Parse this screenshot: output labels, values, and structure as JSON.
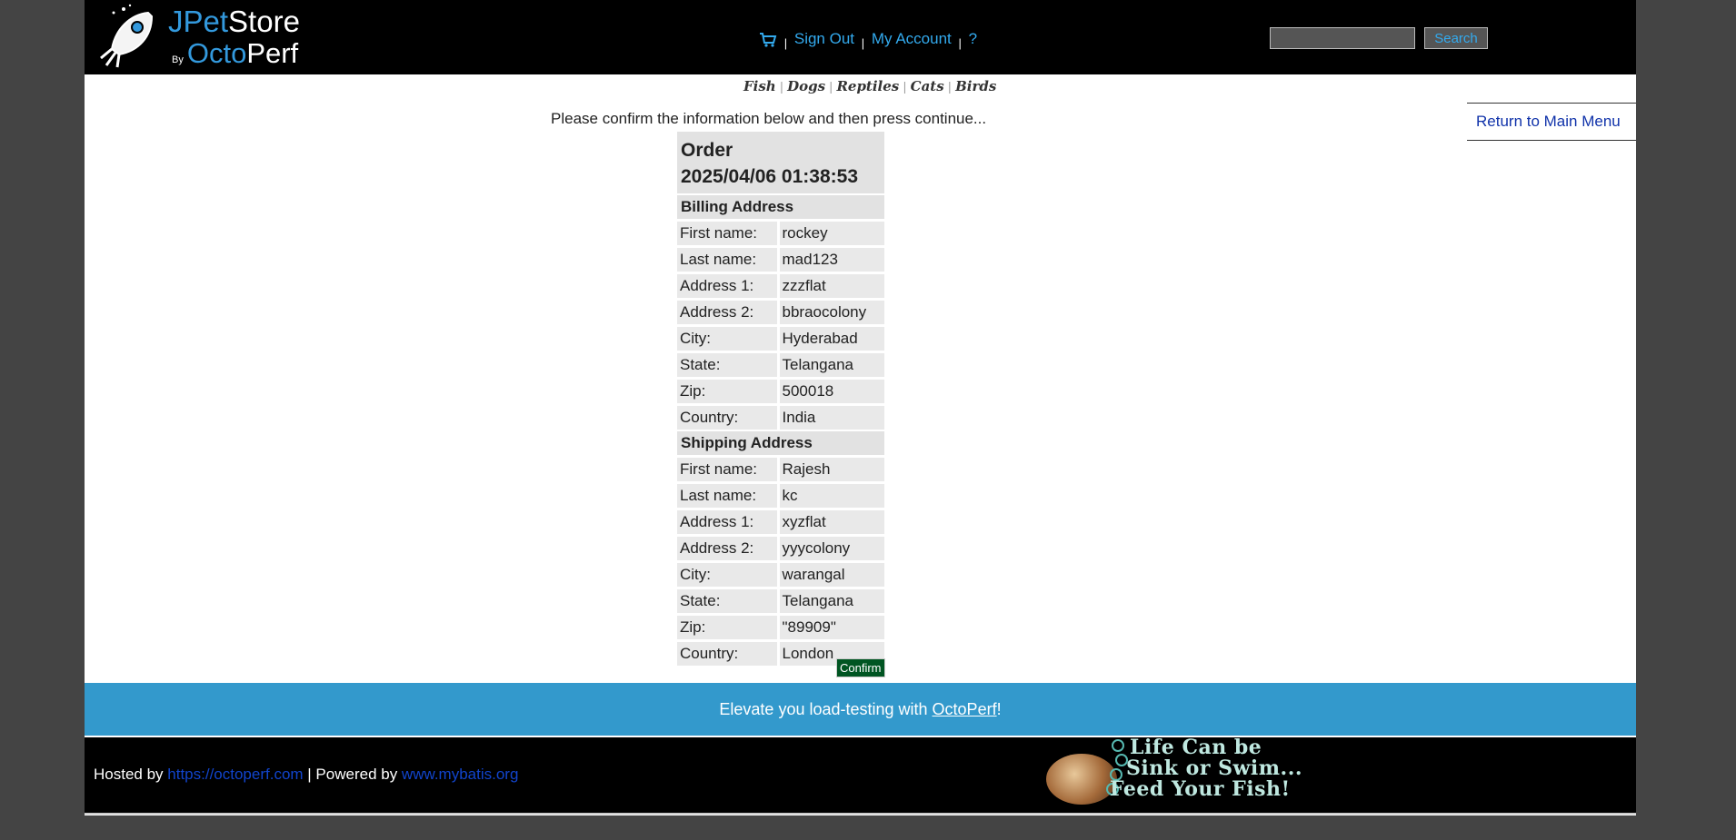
{
  "header": {
    "logo": {
      "part1": "JPet",
      "part2": "Store",
      "by": "By",
      "octo": "Octo",
      "perf": "Perf"
    },
    "menu": {
      "cart_icon": "cart-icon",
      "sign_out": "Sign Out",
      "my_account": "My Account",
      "help": "?",
      "separator": "|"
    },
    "search": {
      "input_value": "",
      "button_label": "Search"
    }
  },
  "quicklinks": [
    "Fish",
    "Dogs",
    "Reptiles",
    "Cats",
    "Birds"
  ],
  "return_menu": {
    "label": "Return to Main Menu"
  },
  "main": {
    "confirm_message": "Please confirm the information below and then press continue...",
    "order_title": "Order",
    "order_datetime": "2025/04/06 01:38:53",
    "billing": {
      "header": "Billing Address",
      "rows": [
        {
          "label": "First name:",
          "value": "rockey"
        },
        {
          "label": "Last name:",
          "value": "mad123"
        },
        {
          "label": "Address 1:",
          "value": "zzzflat"
        },
        {
          "label": "Address 2:",
          "value": "bbraocolony"
        },
        {
          "label": "City:",
          "value": "Hyderabad"
        },
        {
          "label": "State:",
          "value": "Telangana"
        },
        {
          "label": "Zip:",
          "value": "500018"
        },
        {
          "label": "Country:",
          "value": "India"
        }
      ]
    },
    "shipping": {
      "header": "Shipping Address",
      "rows": [
        {
          "label": "First name:",
          "value": "Rajesh"
        },
        {
          "label": "Last name:",
          "value": "kc"
        },
        {
          "label": "Address 1:",
          "value": "xyzflat"
        },
        {
          "label": "Address 2:",
          "value": "yyycolony"
        },
        {
          "label": "City:",
          "value": "warangal"
        },
        {
          "label": "State:",
          "value": "Telangana"
        },
        {
          "label": "Zip:",
          "value": "\"89909\""
        },
        {
          "label": "Country:",
          "value": "London"
        }
      ]
    },
    "confirm_button": "Confirm"
  },
  "footer": {
    "promo_prefix": "Elevate you load-testing with ",
    "promo_link": "OctoPerf",
    "promo_suffix": "!",
    "hosted_by": "Hosted by ",
    "hosted_link": "https://octoperf.com",
    "powered_by": " | Powered by ",
    "powered_link": "www.mybatis.org",
    "banner_line1": "Life Can be",
    "banner_line2": "Sink or Swim...",
    "banner_line3": "Feed Your Fish!"
  },
  "colors": {
    "header_bg": "#000000",
    "link_blue": "#33aaee",
    "promo_bg": "#3399cc",
    "confirm_bg": "#005522",
    "page_bg": "#444444"
  }
}
